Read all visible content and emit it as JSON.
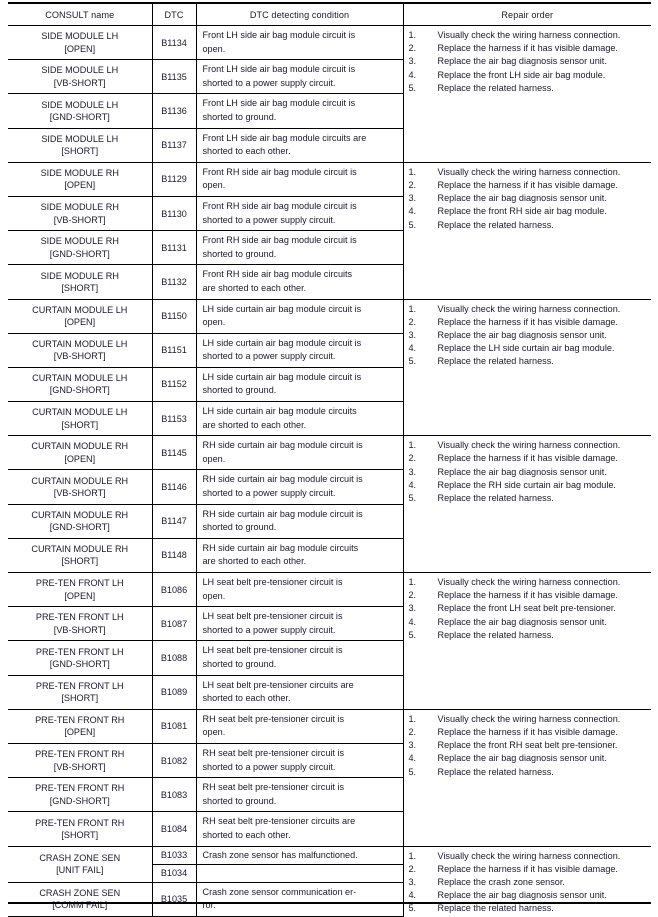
{
  "table": {
    "headers": {
      "consult": "CONSULT name",
      "dtc": "DTC",
      "condition": "DTC detecting condition",
      "repair": "Repair order"
    },
    "groups": [
      {
        "id": "side-module-lh",
        "rows": [
          {
            "consult_line1": "SIDE MODULE LH",
            "consult_line2": "[OPEN]",
            "dtc": "B1134",
            "cond_line1": "Front LH side air bag module circuit is",
            "cond_line2": "open."
          },
          {
            "consult_line1": "SIDE MODULE LH",
            "consult_line2": "[VB-SHORT]",
            "dtc": "B1135",
            "cond_line1": "Front LH side air bag module circuit is",
            "cond_line2": "shorted to a power supply circuit."
          },
          {
            "consult_line1": "SIDE MODULE LH",
            "consult_line2": "[GND-SHORT]",
            "dtc": "B1136",
            "cond_line1": "Front LH side air bag module circuit is",
            "cond_line2": "shorted to ground."
          },
          {
            "consult_line1": "SIDE MODULE LH",
            "consult_line2": "[SHORT]",
            "dtc": "B1137",
            "cond_line1": "Front LH side air bag module circuits are",
            "cond_line2": "shorted to each other."
          }
        ],
        "repair": [
          "Visually check the wiring harness connection.",
          "Replace the harness if it has visible damage.",
          "Replace the air bag diagnosis sensor unit.",
          "Replace the front LH side air bag module.",
          "Replace the related harness."
        ]
      },
      {
        "id": "side-module-rh",
        "rows": [
          {
            "consult_line1": "SIDE MODULE RH",
            "consult_line2": "[OPEN]",
            "dtc": "B1129",
            "cond_line1": "Front RH side air bag module circuit is",
            "cond_line2": "open."
          },
          {
            "consult_line1": "SIDE MODULE RH",
            "consult_line2": "[VB-SHORT]",
            "dtc": "B1130",
            "cond_line1": "Front RH side air bag module circuit is",
            "cond_line2": "shorted to a power supply circuit."
          },
          {
            "consult_line1": "SIDE MODULE RH",
            "consult_line2": "[GND-SHORT]",
            "dtc": "B1131",
            "cond_line1": "Front RH side air bag module circuit is",
            "cond_line2": "shorted to ground."
          },
          {
            "consult_line1": "SIDE MODULE RH",
            "consult_line2": "[SHORT]",
            "dtc": "B1132",
            "cond_line1": "Front RH side air bag module circuits",
            "cond_line2": "are shorted to each other."
          }
        ],
        "repair": [
          "Visually check the wiring harness connection.",
          "Replace the harness if it has visible damage.",
          "Replace the air bag diagnosis sensor unit.",
          "Replace the front RH side air bag module.",
          "Replace the related harness."
        ]
      },
      {
        "id": "curtain-module-lh",
        "rows": [
          {
            "consult_line1": "CURTAIN MODULE LH",
            "consult_line2": "[OPEN]",
            "dtc": "B1150",
            "cond_line1": "LH side curtain air bag module circuit is",
            "cond_line2": "open."
          },
          {
            "consult_line1": "CURTAIN MODULE LH",
            "consult_line2": "[VB-SHORT]",
            "dtc": "B1151",
            "cond_line1": "LH side curtain air bag module circuit is",
            "cond_line2": "shorted to a power supply circuit."
          },
          {
            "consult_line1": "CURTAIN MODULE LH",
            "consult_line2": "[GND-SHORT]",
            "dtc": "B1152",
            "cond_line1": "LH side curtain air bag module circuit is",
            "cond_line2": "shorted to ground."
          },
          {
            "consult_line1": "CURTAIN MODULE LH",
            "consult_line2": "[SHORT]",
            "dtc": "B1153",
            "cond_line1": "LH side curtain air bag module circuits",
            "cond_line2": "are shorted to each other."
          }
        ],
        "repair": [
          "Visually check the wiring harness connection.",
          "Replace the harness if it has visible damage.",
          "Replace the air bag diagnosis sensor unit.",
          "Replace the LH side curtain air bag module.",
          "Replace the related harness."
        ]
      },
      {
        "id": "curtain-module-rh",
        "rows": [
          {
            "consult_line1": "CURTAIN MODULE RH",
            "consult_line2": "[OPEN]",
            "dtc": "B1145",
            "cond_line1": "RH side curtain air bag module circuit is",
            "cond_line2": "open."
          },
          {
            "consult_line1": "CURTAIN MODULE RH",
            "consult_line2": "[VB-SHORT]",
            "dtc": "B1146",
            "cond_line1": "RH side curtain air bag module circuit is",
            "cond_line2": "shorted to a power supply circuit."
          },
          {
            "consult_line1": "CURTAIN MODULE RH",
            "consult_line2": "[GND-SHORT]",
            "dtc": "B1147",
            "cond_line1": "RH side curtain air bag module circuit is",
            "cond_line2": "shorted to ground."
          },
          {
            "consult_line1": "CURTAIN MODULE RH",
            "consult_line2": "[SHORT]",
            "dtc": "B1148",
            "cond_line1": "RH side curtain air bag module circuits",
            "cond_line2": "are shorted to each other."
          }
        ],
        "repair": [
          "Visually check the wiring harness connection.",
          "Replace the harness if it has visible damage.",
          "Replace the air bag diagnosis sensor unit.",
          "Replace the RH side curtain air bag module.",
          "Replace the related harness."
        ]
      },
      {
        "id": "pre-ten-front-lh",
        "rows": [
          {
            "consult_line1": "PRE-TEN FRONT LH",
            "consult_line2": "[OPEN]",
            "dtc": "B1086",
            "cond_line1": "LH seat belt pre-tensioner circuit is",
            "cond_line2": "open."
          },
          {
            "consult_line1": "PRE-TEN FRONT LH",
            "consult_line2": "[VB-SHORT]",
            "dtc": "B1087",
            "cond_line1": "LH seat belt pre-tensioner circuit is",
            "cond_line2": "shorted to a power supply circuit."
          },
          {
            "consult_line1": "PRE-TEN FRONT LH",
            "consult_line2": "[GND-SHORT]",
            "dtc": "B1088",
            "cond_line1": "LH seat belt pre-tensioner circuit is",
            "cond_line2": "shorted to ground."
          },
          {
            "consult_line1": "PRE-TEN FRONT LH",
            "consult_line2": "[SHORT]",
            "dtc": "B1089",
            "cond_line1": "LH seat belt pre-tensioner circuits are",
            "cond_line2": "shorted to each other."
          }
        ],
        "repair": [
          "Visually check the wiring harness connection.",
          "Replace the harness if it has visible damage.",
          "Replace the front LH seat belt pre-tensioner.",
          "Replace the air bag diagnosis sensor unit.",
          "Replace the related harness."
        ]
      },
      {
        "id": "pre-ten-front-rh",
        "rows": [
          {
            "consult_line1": "PRE-TEN FRONT RH",
            "consult_line2": "[OPEN]",
            "dtc": "B1081",
            "cond_line1": "RH seat belt pre-tensioner circuit is",
            "cond_line2": "open."
          },
          {
            "consult_line1": "PRE-TEN FRONT RH",
            "consult_line2": "[VB-SHORT]",
            "dtc": "B1082",
            "cond_line1": "RH seat belt pre-tensioner circuit is",
            "cond_line2": "shorted to a power supply circuit."
          },
          {
            "consult_line1": "PRE-TEN FRONT RH",
            "consult_line2": "[GND-SHORT]",
            "dtc": "B1083",
            "cond_line1": "RH seat belt pre-tensioner circuit is",
            "cond_line2": "shorted to ground."
          },
          {
            "consult_line1": "PRE-TEN FRONT RH",
            "consult_line2": "[SHORT]",
            "dtc": "B1084",
            "cond_line1": "RH seat belt pre-tensioner circuits are",
            "cond_line2": "shorted to each other."
          }
        ],
        "repair": [
          "Visually check the wiring harness connection.",
          "Replace the harness if it has visible damage.",
          "Replace the front RH seat belt pre-tensioner.",
          "Replace the air bag diagnosis sensor unit.",
          "Replace the related harness."
        ]
      },
      {
        "id": "crash-zone-sen",
        "rows": [
          {
            "consult_line1": "CRASH ZONE SEN",
            "consult_line2": "[UNIT FAIL]",
            "dtc_split_top": "B1033",
            "dtc_split_bottom": "B1034",
            "cond_split_top": "Crash zone sensor has malfunctioned.",
            "cond_split_bottom": ""
          },
          {
            "consult_line1": "CRASH ZONE SEN",
            "consult_line2": "[COMM FAIL]",
            "dtc": "B1035",
            "cond_line1": "Crash zone sensor communication er-",
            "cond_line2": "ror."
          }
        ],
        "repair": [
          "Visually check the wiring harness connection.",
          "Replace the harness if it has visible damage.",
          "Replace the crash zone sensor.",
          "Replace the air bag diagnosis sensor unit.",
          "Replace the related harness."
        ]
      }
    ]
  }
}
